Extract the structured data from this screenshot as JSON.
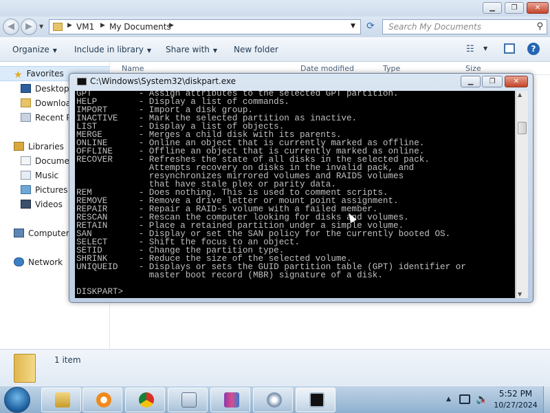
{
  "explorer": {
    "address": {
      "segments": [
        "VM1",
        "My Documents"
      ]
    },
    "search_placeholder": "Search My Documents",
    "toolbar": {
      "organize": "Organize",
      "include_in_library": "Include in library",
      "share_with": "Share with",
      "new_folder": "New folder"
    },
    "navpane": {
      "favorites": "Favorites",
      "desktop": "Desktop",
      "downloads": "Downloads",
      "recent": "Recent Places",
      "libraries": "Libraries",
      "documents": "Documents",
      "music": "Music",
      "pictures": "Pictures",
      "videos": "Videos",
      "computer": "Computer",
      "network": "Network"
    },
    "columns": [
      "Name",
      "Date modified",
      "Type",
      "Size"
    ],
    "details": {
      "item_count": "1 item"
    }
  },
  "console": {
    "title": "C:\\Windows\\System32\\diskpart.exe",
    "lines": [
      "GPT         - Assign attributes to the selected GPT partition.",
      "HELP        - Display a list of commands.",
      "IMPORT      - Import a disk group.",
      "INACTIVE    - Mark the selected partition as inactive.",
      "LIST        - Display a list of objects.",
      "MERGE       - Merges a child disk with its parents.",
      "ONLINE      - Online an object that is currently marked as offline.",
      "OFFLINE     - Offline an object that is currently marked as online.",
      "RECOVER     - Refreshes the state of all disks in the selected pack.",
      "              Attempts recovery on disks in the invalid pack, and",
      "              resynchronizes mirrored volumes and RAID5 volumes",
      "              that have stale plex or parity data.",
      "REM         - Does nothing. This is used to comment scripts.",
      "REMOVE      - Remove a drive letter or mount point assignment.",
      "REPAIR      - Repair a RAID-5 volume with a failed member.",
      "RESCAN      - Rescan the computer looking for disks and volumes.",
      "RETAIN      - Place a retained partition under a simple volume.",
      "SAN         - Display or set the SAN policy for the currently booted OS.",
      "SELECT      - Shift the focus to an object.",
      "SETID       - Change the partition type.",
      "SHRINK      - Reduce the size of the selected volume.",
      "UNIQUEID    - Displays or sets the GUID partition table (GPT) identifier or",
      "              master boot record (MBR) signature of a disk.",
      "",
      "DISKPART>"
    ]
  },
  "taskbar": {
    "apps": [
      "explorer-icon",
      "media-player-icon",
      "chrome-icon",
      "calculator-icon",
      "winrar-icon",
      "xp-mode-icon",
      "command-prompt-icon"
    ],
    "clock": {
      "time": "5:52 PM",
      "date": "10/27/2024"
    }
  },
  "colors": {
    "console_bg": "#000000",
    "console_fg": "#c0c0c0",
    "taskbar": "#a9c3dc"
  }
}
